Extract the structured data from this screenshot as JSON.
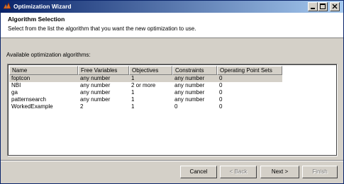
{
  "window": {
    "title": "Optimization Wizard",
    "icon": "matlab-icon",
    "controls": [
      "minimize-icon",
      "maximize-icon",
      "close-icon"
    ]
  },
  "header": {
    "title": "Algorithm Selection",
    "description": "Select from the list the algorithm that you want the new optimization to use."
  },
  "list": {
    "label": "Available optimization algorithms:",
    "columns": [
      "Name",
      "Free Variables",
      "Objectives",
      "Constraints",
      "Operating Point Sets"
    ],
    "rows": [
      [
        "foptcon",
        "any number",
        "1",
        "any number",
        "0"
      ],
      [
        "NBI",
        "any number",
        "2 or more",
        "any number",
        "0"
      ],
      [
        "ga",
        "any number",
        "1",
        "any number",
        "0"
      ],
      [
        "patternsearch",
        "any number",
        "1",
        "any number",
        "0"
      ],
      [
        "WorkedExample",
        "2",
        "1",
        "0",
        "0"
      ]
    ],
    "selected_row": 0
  },
  "buttons": {
    "cancel": "Cancel",
    "back": "< Back",
    "next": "Next >",
    "finish": "Finish"
  }
}
